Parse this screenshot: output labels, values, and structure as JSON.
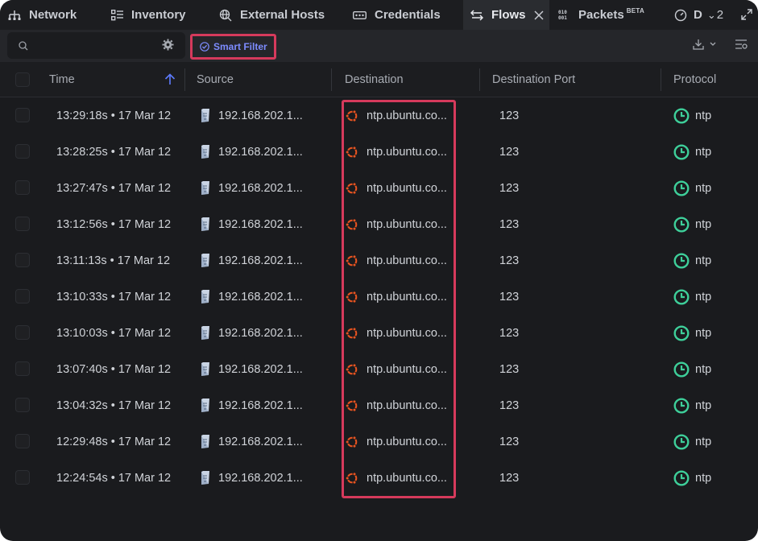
{
  "tabs": [
    {
      "label": "Network",
      "icon": "network-icon"
    },
    {
      "label": "Inventory",
      "icon": "inventory-icon"
    },
    {
      "label": "External Hosts",
      "icon": "external-hosts-icon"
    },
    {
      "label": "Credentials",
      "icon": "credentials-icon"
    },
    {
      "label": "Flows",
      "icon": "flows-icon",
      "active": true
    },
    {
      "label": "Packets",
      "badge": "BETA",
      "icon": "packets-icon"
    },
    {
      "label": "D",
      "icon": "dashboard-icon"
    }
  ],
  "tab_overflow": "2",
  "toolbar": {
    "search_placeholder": "",
    "smart_filter_label": "Smart Filter"
  },
  "table": {
    "columns": [
      "Time",
      "Source",
      "Destination",
      "Destination Port",
      "Protocol"
    ],
    "rows": [
      {
        "time": "13:29:18s • 17 Mar 12",
        "source": "192.168.202.1...",
        "destination": "ntp.ubuntu.co...",
        "port": "123",
        "protocol": "ntp"
      },
      {
        "time": "13:28:25s • 17 Mar 12",
        "source": "192.168.202.1...",
        "destination": "ntp.ubuntu.co...",
        "port": "123",
        "protocol": "ntp"
      },
      {
        "time": "13:27:47s • 17 Mar 12",
        "source": "192.168.202.1...",
        "destination": "ntp.ubuntu.co...",
        "port": "123",
        "protocol": "ntp"
      },
      {
        "time": "13:12:56s • 17 Mar 12",
        "source": "192.168.202.1...",
        "destination": "ntp.ubuntu.co...",
        "port": "123",
        "protocol": "ntp"
      },
      {
        "time": "13:11:13s • 17 Mar 12",
        "source": "192.168.202.1...",
        "destination": "ntp.ubuntu.co...",
        "port": "123",
        "protocol": "ntp"
      },
      {
        "time": "13:10:33s • 17 Mar 12",
        "source": "192.168.202.1...",
        "destination": "ntp.ubuntu.co...",
        "port": "123",
        "protocol": "ntp"
      },
      {
        "time": "13:10:03s • 17 Mar 12",
        "source": "192.168.202.1...",
        "destination": "ntp.ubuntu.co...",
        "port": "123",
        "protocol": "ntp"
      },
      {
        "time": "13:07:40s • 17 Mar 12",
        "source": "192.168.202.1...",
        "destination": "ntp.ubuntu.co...",
        "port": "123",
        "protocol": "ntp"
      },
      {
        "time": "13:04:32s • 17 Mar 12",
        "source": "192.168.202.1...",
        "destination": "ntp.ubuntu.co...",
        "port": "123",
        "protocol": "ntp"
      },
      {
        "time": "12:29:48s • 17 Mar 12",
        "source": "192.168.202.1...",
        "destination": "ntp.ubuntu.co...",
        "port": "123",
        "protocol": "ntp"
      },
      {
        "time": "12:24:54s • 17 Mar 12",
        "source": "192.168.202.1...",
        "destination": "ntp.ubuntu.co...",
        "port": "123",
        "protocol": "ntp"
      }
    ]
  },
  "colors": {
    "accent": "#7d8cff",
    "highlight": "#d63a5c",
    "protocol": "#3ecf9a",
    "ubuntu": "#e95420"
  }
}
